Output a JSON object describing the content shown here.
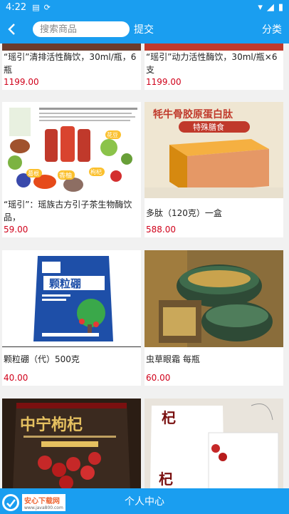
{
  "status": {
    "time": "4:22"
  },
  "header": {
    "search_placeholder": "搜索商品",
    "submit_label": "提交",
    "category_label": "分类"
  },
  "products": [
    {
      "title": "“瑶引”清排活性酶饮，30ml/瓶，6瓶",
      "price": "1199.00"
    },
    {
      "title": "“瑶引”动力活性酶饮，30ml/瓶×6支",
      "price": "1199.00"
    },
    {
      "title": "“瑶引”：瑶族古方引子茶生物酶饮品，",
      "price": "59.00",
      "img_text": [
        "葛根",
        "香柚",
        "枸杞",
        "花豆"
      ]
    },
    {
      "title": "多肽（120克）一盒",
      "price": "588.00",
      "img_text": [
        "牦牛骨胶原蛋白肽",
        "特殊膳食"
      ]
    },
    {
      "title": "颗粒硼（代）500克",
      "price": "40.00",
      "img_text": [
        "颗粒硼"
      ]
    },
    {
      "title": "虫草眼霜 每瓶",
      "price": "60.00"
    },
    {
      "title": "",
      "price": "",
      "img_text": [
        "中宁枸杞"
      ]
    },
    {
      "title": "",
      "price": "",
      "img_text": [
        "杞"
      ]
    }
  ],
  "bottom": {
    "label": "个人中心"
  },
  "watermark": {
    "name": "安心下载网",
    "url": "www.java800.com"
  }
}
